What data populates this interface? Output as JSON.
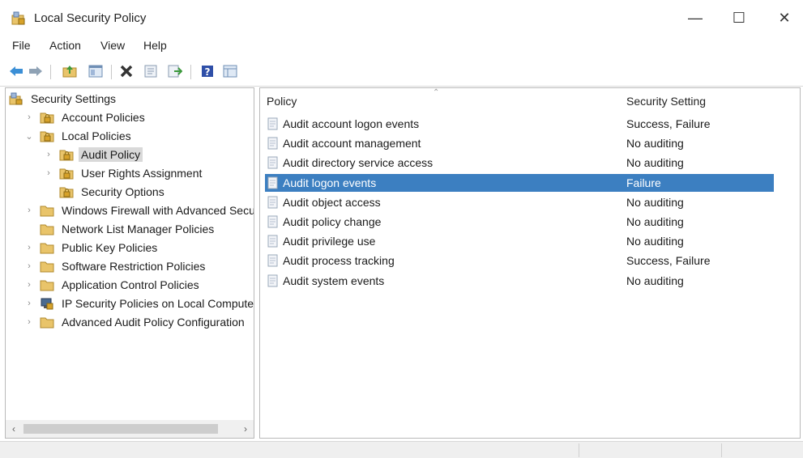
{
  "window": {
    "title": "Local Security Policy",
    "controls": {
      "minimize": "—",
      "maximize": "☐",
      "close": "✕"
    }
  },
  "menu": [
    "File",
    "Action",
    "View",
    "Help"
  ],
  "toolbar_icons": [
    "back-arrow-icon",
    "forward-arrow-icon",
    "up-folder-icon",
    "show-hide-tree-icon",
    "delete-icon",
    "properties-icon",
    "export-list-icon",
    "help-icon",
    "console-view-icon"
  ],
  "tree": [
    {
      "label": "Security Settings",
      "icon": "security-settings-icon",
      "arrow": "",
      "level": 0
    },
    {
      "label": "Account Policies",
      "icon": "folder-lock-icon",
      "arrow": "›",
      "level": 1
    },
    {
      "label": "Local Policies",
      "icon": "folder-lock-icon",
      "arrow": "⌄",
      "level": 1
    },
    {
      "label": "Audit Policy",
      "icon": "folder-lock-icon",
      "arrow": "›",
      "level": 2,
      "selected": true
    },
    {
      "label": "User Rights Assignment",
      "icon": "folder-lock-icon",
      "arrow": "›",
      "level": 2
    },
    {
      "label": "Security Options",
      "icon": "folder-lock-icon",
      "arrow": "",
      "level": 2
    },
    {
      "label": "Windows Firewall with Advanced Secu",
      "icon": "folder-icon",
      "arrow": "›",
      "level": 1
    },
    {
      "label": "Network List Manager Policies",
      "icon": "folder-icon",
      "arrow": "",
      "level": 1
    },
    {
      "label": "Public Key Policies",
      "icon": "folder-icon",
      "arrow": "›",
      "level": 1
    },
    {
      "label": "Software Restriction Policies",
      "icon": "folder-icon",
      "arrow": "›",
      "level": 1
    },
    {
      "label": "Application Control Policies",
      "icon": "folder-icon",
      "arrow": "›",
      "level": 1
    },
    {
      "label": "IP Security Policies on Local Compute",
      "icon": "ip-security-icon",
      "arrow": "›",
      "level": 1
    },
    {
      "label": "Advanced Audit Policy Configuration",
      "icon": "folder-icon",
      "arrow": "›",
      "level": 1
    }
  ],
  "list": {
    "columns": {
      "policy": "Policy",
      "setting": "Security Setting"
    },
    "rows": [
      {
        "policy": "Audit account logon events",
        "setting": "Success, Failure"
      },
      {
        "policy": "Audit account management",
        "setting": "No auditing"
      },
      {
        "policy": "Audit directory service access",
        "setting": "No auditing"
      },
      {
        "policy": "Audit logon events",
        "setting": "Failure",
        "selected": true
      },
      {
        "policy": "Audit object access",
        "setting": "No auditing"
      },
      {
        "policy": "Audit policy change",
        "setting": "No auditing"
      },
      {
        "policy": "Audit privilege use",
        "setting": "No auditing"
      },
      {
        "policy": "Audit process tracking",
        "setting": "Success, Failure"
      },
      {
        "policy": "Audit system events",
        "setting": "No auditing"
      }
    ]
  },
  "colors": {
    "selection": "#3c7fc1",
    "tree_selection": "#d9d9d9",
    "folder": "#e9c46a"
  }
}
